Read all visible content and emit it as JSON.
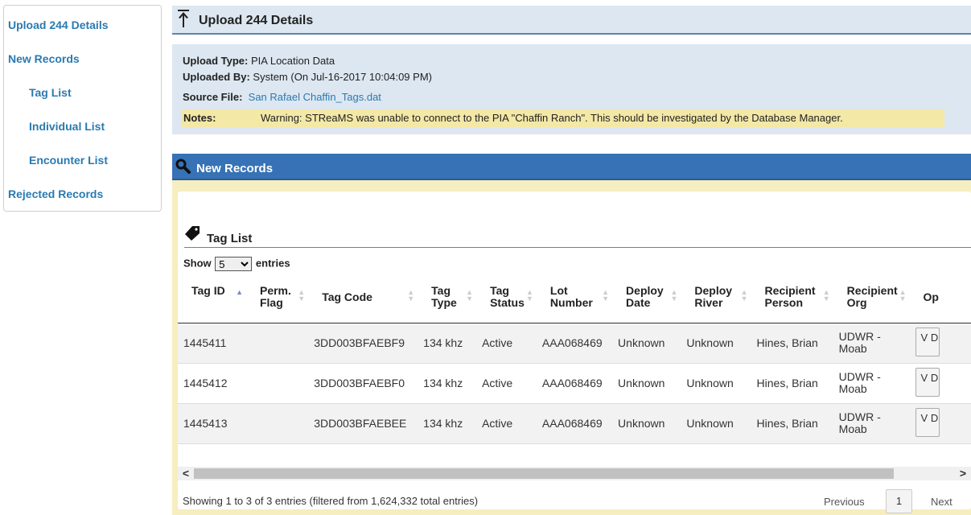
{
  "sidebar": {
    "items": [
      {
        "label": "Upload 244 Details"
      },
      {
        "label": "New Records"
      },
      {
        "label": "Tag List"
      },
      {
        "label": "Individual List"
      },
      {
        "label": "Encounter List"
      },
      {
        "label": "Rejected Records"
      }
    ]
  },
  "upload": {
    "title": "Upload 244 Details",
    "type_label": "Upload Type:",
    "type_value": "PIA Location Data",
    "by_label": "Uploaded By:",
    "by_value": "System (On Jul-16-2017 10:04:09 PM)",
    "source_label": "Source File:",
    "source_value": "San Rafael Chaffin_Tags.dat",
    "notes_label": "Notes:",
    "notes_value": "Warning: STReaMS was unable to connect to the PIA \"Chaffin Ranch\". This should be investigated by the Database Manager."
  },
  "records": {
    "title": "New Records",
    "taglist_title": "Tag List",
    "show_label": "Show",
    "entries_label": "entries",
    "page_size": "5",
    "columns": [
      {
        "label": "Tag ID"
      },
      {
        "label": "Perm. Flag"
      },
      {
        "label": "Tag Code"
      },
      {
        "label": "Tag Type"
      },
      {
        "label": "Tag Status"
      },
      {
        "label": "Lot Number"
      },
      {
        "label": "Deploy Date"
      },
      {
        "label": "Deploy River"
      },
      {
        "label": "Recipient Person"
      },
      {
        "label": "Recipient Org"
      },
      {
        "label": "Op"
      }
    ],
    "rows": [
      {
        "tag_id": "1445411",
        "perm": "",
        "code": "3DD003BFAEBF9",
        "type": "134 khz",
        "status": "Active",
        "lot": "AAA068469",
        "date": "Unknown",
        "river": "Unknown",
        "person": "Hines, Brian",
        "org": "UDWR - Moab",
        "btn": "V D"
      },
      {
        "tag_id": "1445412",
        "perm": "",
        "code": "3DD003BFAEBF0",
        "type": "134 khz",
        "status": "Active",
        "lot": "AAA068469",
        "date": "Unknown",
        "river": "Unknown",
        "person": "Hines, Brian",
        "org": "UDWR - Moab",
        "btn": "V D"
      },
      {
        "tag_id": "1445413",
        "perm": "",
        "code": "3DD003BFAEBEE",
        "type": "134 khz",
        "status": "Active",
        "lot": "AAA068469",
        "date": "Unknown",
        "river": "Unknown",
        "person": "Hines, Brian",
        "org": "UDWR - Moab",
        "btn": "V D"
      }
    ],
    "info": "Showing 1 to 3 of 3 entries (filtered from 1,624,332 total entries)",
    "prev_label": "Previous",
    "page": "1",
    "next_label": "Next"
  },
  "colors": {
    "link": "#2a7ab0",
    "panel_bg": "#dde7f1",
    "records_header": "#3672b5",
    "notes_bg": "#f3e8a6",
    "records_bg": "#f6eec0"
  }
}
